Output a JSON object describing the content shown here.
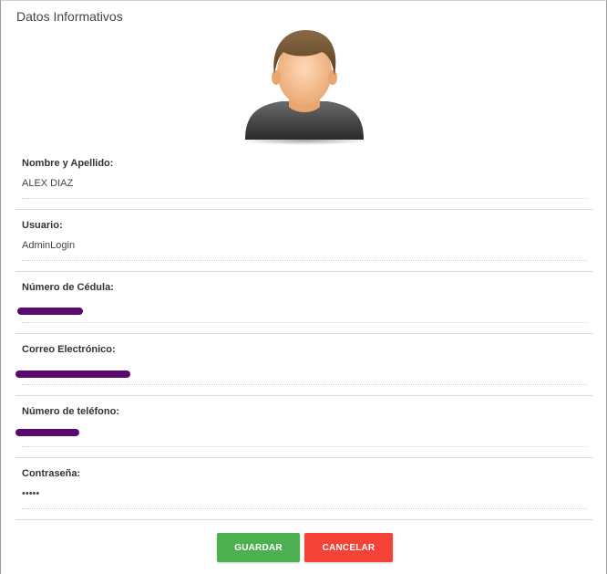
{
  "panel": {
    "title": "Datos Informativos"
  },
  "avatar": {
    "icon": "user-avatar-icon"
  },
  "fields": [
    {
      "label": "Nombre y Apellido:",
      "value": "ALEX DIAZ"
    },
    {
      "label": "Usuario:",
      "value": "AdminLogin"
    },
    {
      "label": "Número de Cédula:",
      "value": ""
    },
    {
      "label": "Correo Electrónico:",
      "value": ""
    },
    {
      "label": "Número de teléfono:",
      "value": ""
    },
    {
      "label": "Contraseña:",
      "value": "•••••"
    }
  ],
  "actions": {
    "save": "GUARDAR",
    "cancel": "CANCELAR"
  },
  "colors": {
    "save": "#4caf50",
    "cancel": "#f44336",
    "redaction": "#5a0a6e"
  }
}
